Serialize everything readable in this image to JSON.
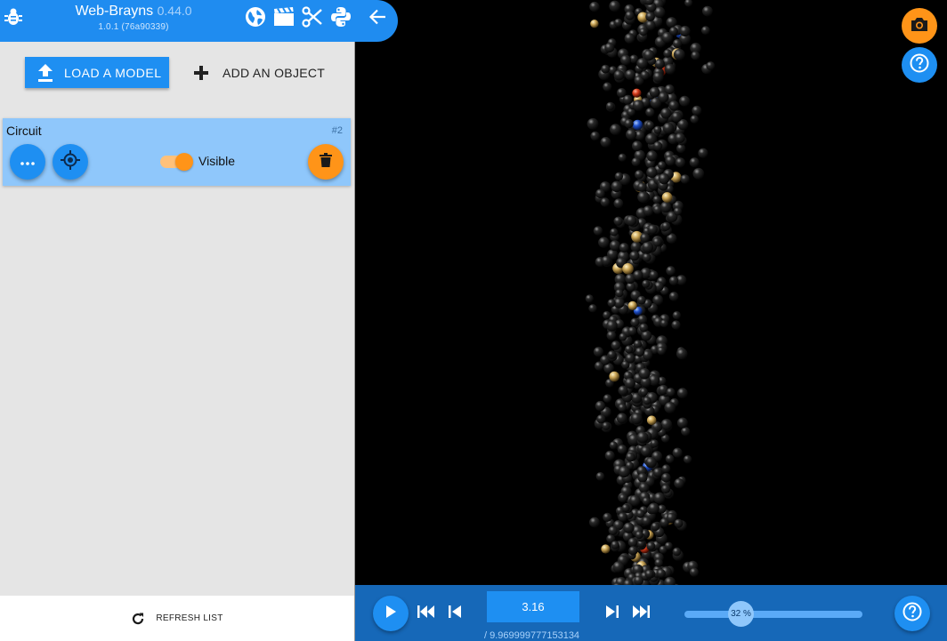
{
  "header": {
    "title": "Web-Brayns",
    "version": "0.44.0",
    "build": "1.0.1 (76a90339)",
    "icons": [
      "bug-icon",
      "globe-icon",
      "clapperboard-icon",
      "scissors-icon",
      "python-icon",
      "arrow-left-icon"
    ]
  },
  "actions": {
    "load_label": "LOAD A MODEL",
    "add_label": "ADD AN OBJECT"
  },
  "model": {
    "name": "Circuit",
    "id": "#2",
    "visible_label": "Visible",
    "visible": true
  },
  "footer": {
    "refresh_label": "REFRESH LIST"
  },
  "animation": {
    "frame": "3.16",
    "total": "/ 9.969999777153134",
    "speed": "32 %",
    "speed_value": 0.32
  },
  "colors": {
    "primary": "#1f8cf0",
    "primary_dark": "#1668b8",
    "accent": "#ff9418",
    "card": "#8fc7fb",
    "panel": "#e5e5e5",
    "viewport": "#000000"
  }
}
